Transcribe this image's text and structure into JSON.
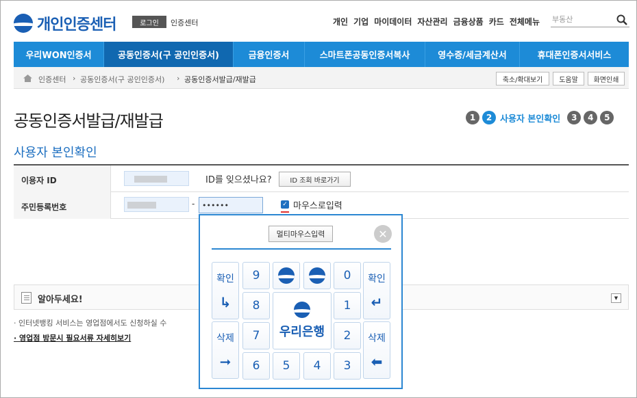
{
  "header": {
    "logo_text": "개인인증센터",
    "login_badge": "로그인",
    "center_link": "인증센터",
    "top_menu": [
      "개인",
      "기업",
      "마이데이터",
      "자산관리",
      "금융상품",
      "카드",
      "전체메뉴"
    ],
    "search_placeholder": "부동산"
  },
  "nav": [
    {
      "label": "우리WON인증서"
    },
    {
      "label": "공동인증서(구 공인인증서)"
    },
    {
      "label": "금융인증서"
    },
    {
      "label": "스마트폰공동인증서복사"
    },
    {
      "label": "영수증/세금계산서"
    },
    {
      "label": "휴대폰인증서서비스"
    }
  ],
  "breadcrumb": [
    "인증센터",
    "공동인증서(구 공인인증서)",
    "공동인증서발급/재발급"
  ],
  "tools": [
    "축소/확대보기",
    "도움말",
    "화면인쇄"
  ],
  "page_title": "공동인증서발급/재발급",
  "steps": {
    "items": [
      "1",
      "2",
      "3",
      "4",
      "5"
    ],
    "active_label": "사용자 본인확인"
  },
  "section_title": "사용자 본인확인",
  "form": {
    "user_id_label": "이용자 ID",
    "forgot_id_text": "ID를 잊으셨나요?",
    "id_lookup_button": "ID 조회 바로가기",
    "rrn_label": "주민등록번호",
    "rrn_dash": "-",
    "rrn_back_value": "••••••",
    "mouse_input_checked": true,
    "mouse_input_label": "마우스로입력"
  },
  "notice": {
    "title": "알아두세요!",
    "bullet1": "· 인터넷뱅킹 서비스는 영업점에서도 신청하실 수",
    "bullet2": "· 영업점 방문시 필요서류 자세히보기"
  },
  "keypad": {
    "multi_input_button": "멀티마우스입력",
    "confirm_label": "확인",
    "delete_label": "삭제",
    "digits": [
      "9",
      "0",
      "8",
      "1",
      "7",
      "2",
      "6",
      "5",
      "4",
      "3"
    ],
    "bank_name": "우리은행"
  }
}
